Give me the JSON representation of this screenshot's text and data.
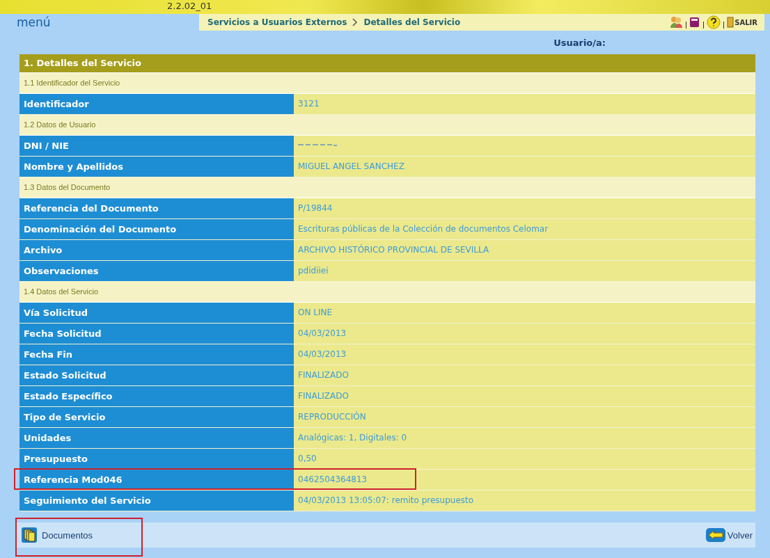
{
  "banner": {
    "version": "2.2.02_01"
  },
  "nav": {
    "menu": "menú",
    "breadcrumb": [
      "Servicios a Usuarios Externos",
      "Detalles del Servicio"
    ],
    "exit": "SALIR"
  },
  "user_label": "Usuario/a:",
  "section": {
    "title": "1. Detalles del Servicio",
    "rows": [
      {
        "kind": "subheader",
        "label": "1.1 Identificador del Servicio"
      },
      {
        "kind": "field",
        "label": "Identificador",
        "value": "3121",
        "highlighted": false
      },
      {
        "kind": "subheader",
        "label": "1.2 Datos de Usuario"
      },
      {
        "kind": "redacted",
        "label": "DNI / NIE",
        "highlighted": false
      },
      {
        "kind": "field",
        "label": "Nombre y Apellidos",
        "value": "MIGUEL ANGEL  SANCHEZ",
        "highlighted": false
      },
      {
        "kind": "subheader",
        "label": "1.3 Datos del Documento"
      },
      {
        "kind": "field",
        "label": "Referencia del Documento",
        "value": "P/19844",
        "highlighted": false
      },
      {
        "kind": "field",
        "label": "Denominación del Documento",
        "value": "Escrituras públicas de la Colección de documentos Celomar",
        "highlighted": false
      },
      {
        "kind": "field",
        "label": "Archivo",
        "value": "ARCHIVO HISTÓRICO PROVINCIAL DE SEVILLA",
        "highlighted": false
      },
      {
        "kind": "field",
        "label": "Observaciones",
        "value": "pdidiiei",
        "highlighted": false
      },
      {
        "kind": "subheader",
        "label": "1.4 Datos del Servicio"
      },
      {
        "kind": "field",
        "label": "Vía Solicitud",
        "value": "ON LINE",
        "highlighted": false
      },
      {
        "kind": "field",
        "label": "Fecha Solicitud",
        "value": "04/03/2013",
        "highlighted": false
      },
      {
        "kind": "field",
        "label": "Fecha Fin",
        "value": "04/03/2013",
        "highlighted": false
      },
      {
        "kind": "field",
        "label": "Estado Solicitud",
        "value": "FINALIZADO",
        "highlighted": false
      },
      {
        "kind": "field",
        "label": "Estado Específico",
        "value": "FINALIZADO",
        "highlighted": false
      },
      {
        "kind": "field",
        "label": "Tipo de Servicio",
        "value": "REPRODUCCIÓN",
        "highlighted": false
      },
      {
        "kind": "field",
        "label": "Unidades",
        "value": "Analógicas: 1, Digitales: 0",
        "highlighted": false
      },
      {
        "kind": "field",
        "label": "Presupuesto",
        "value": "0,50",
        "highlighted": false
      },
      {
        "kind": "field",
        "label": "Referencia Mod046",
        "value": "0462504364813",
        "highlighted": true
      },
      {
        "kind": "field",
        "label": "Seguimiento del Servicio",
        "value": "04/03/2013 13:05:07: remito presupuesto",
        "highlighted": false
      }
    ]
  },
  "footer": {
    "buttons": [
      {
        "label": "Documentos",
        "highlighted": true
      },
      {
        "label": "Volver",
        "highlighted": false
      }
    ]
  }
}
